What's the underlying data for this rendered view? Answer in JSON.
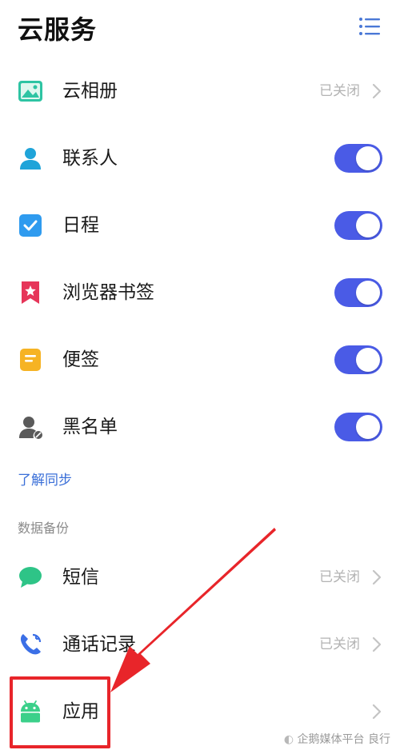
{
  "header": {
    "title": "云服务"
  },
  "sync_items": [
    {
      "label": "云相册",
      "control": "status",
      "status": "已关闭",
      "icon": "photo-icon",
      "color": "#2ec4a3"
    },
    {
      "label": "联系人",
      "control": "toggle",
      "enabled": true,
      "icon": "person-icon",
      "color": "#1fa4d9"
    },
    {
      "label": "日程",
      "control": "toggle",
      "enabled": true,
      "icon": "checkbox-icon",
      "color": "#2f9bef"
    },
    {
      "label": "浏览器书签",
      "control": "toggle",
      "enabled": true,
      "icon": "bookmark-star-icon",
      "color": "#e63559"
    },
    {
      "label": "便签",
      "control": "toggle",
      "enabled": true,
      "icon": "note-icon",
      "color": "#f6b324"
    },
    {
      "label": "黑名单",
      "control": "toggle",
      "enabled": true,
      "icon": "blocked-person-icon",
      "color": "#5a5a5a"
    }
  ],
  "learn_sync_link": "了解同步",
  "backup_section": {
    "title": "数据备份",
    "items": [
      {
        "label": "短信",
        "control": "status",
        "status": "已关闭",
        "icon": "chat-bubble-icon",
        "color": "#2ec487"
      },
      {
        "label": "通话记录",
        "control": "status",
        "status": "已关闭",
        "icon": "phone-icon",
        "color": "#3b6fe6"
      },
      {
        "label": "应用",
        "control": "chevron",
        "icon": "android-icon",
        "color": "#3bd08a"
      }
    ]
  },
  "watermark": "企鹅媒体平台 良行",
  "colors": {
    "toggle_on": "#4a5be6",
    "link": "#3a6fd8",
    "annotation": "#e8252a"
  }
}
